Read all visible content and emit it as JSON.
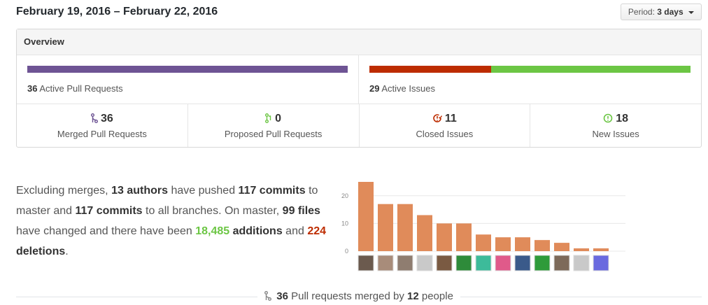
{
  "header": {
    "date_range": "February 19, 2016 – February 22, 2016",
    "period_prefix": "Period:",
    "period_value": "3 days"
  },
  "overview": {
    "title": "Overview",
    "pull_requests": {
      "count": "36",
      "caption": "Active Pull Requests",
      "color": "#6e5494"
    },
    "issues": {
      "count": "29",
      "caption": "Active Issues",
      "closed_fraction": 0.379,
      "closed_color": "#bd2c00",
      "new_color": "#6cc644"
    },
    "stats": [
      {
        "icon": "git-merge-icon",
        "value": "36",
        "label": "Merged Pull Requests",
        "color": "#6e5494"
      },
      {
        "icon": "git-pull-request-icon",
        "value": "0",
        "label": "Proposed Pull Requests",
        "color": "#6cc644"
      },
      {
        "icon": "issue-closed-icon",
        "value": "11",
        "label": "Closed Issues",
        "color": "#bd2c00"
      },
      {
        "icon": "issue-opened-icon",
        "value": "18",
        "label": "New Issues",
        "color": "#6cc644"
      }
    ]
  },
  "summary": {
    "t1": "Excluding merges,",
    "authors": "13 authors",
    "t2": "have pushed",
    "commits_master": "117 commits",
    "t3": "to master and",
    "commits_all": "117 commits",
    "t4": "to all branches. On master,",
    "files": "99 files",
    "t5": "have changed and there have been",
    "additions_num": "18,485",
    "additions_word": "additions",
    "t6": "and",
    "deletions_num": "224",
    "deletions_word": "deletions",
    "t7": "."
  },
  "chart_data": {
    "type": "bar",
    "categories": [
      "author-1",
      "author-2",
      "author-3",
      "author-4",
      "author-5",
      "author-6",
      "author-7",
      "author-8",
      "author-9",
      "author-10",
      "author-11",
      "author-12",
      "author-13"
    ],
    "values": [
      25,
      17,
      17,
      13,
      10,
      10,
      6,
      5,
      5,
      4,
      3,
      1,
      1
    ],
    "ylim": [
      0,
      25
    ],
    "yticks": [
      "0",
      "10",
      "20"
    ],
    "bar_color": "#e08b5a",
    "grid": true
  },
  "footer": {
    "count": "36",
    "t1": "Pull requests merged by",
    "people": "12",
    "t2": "people"
  }
}
